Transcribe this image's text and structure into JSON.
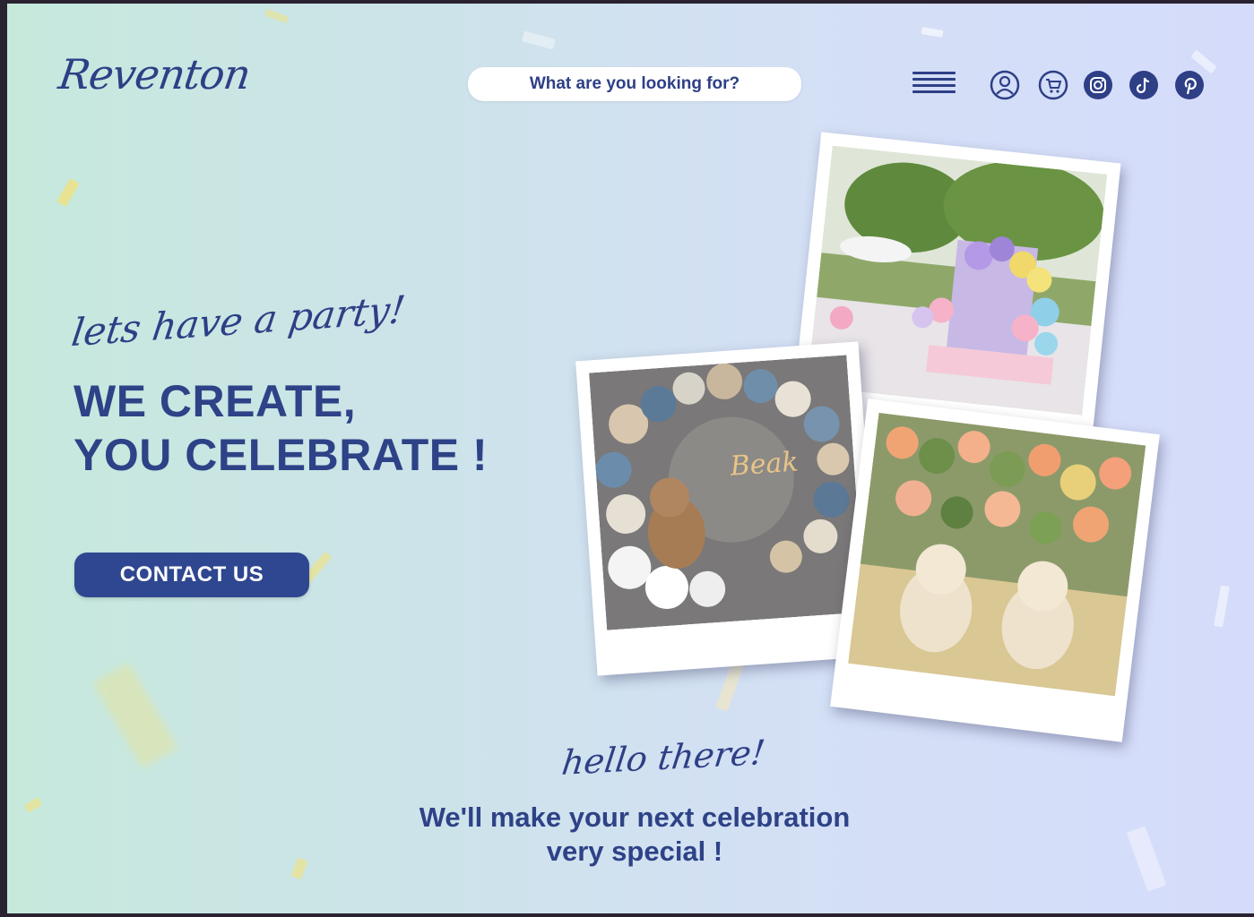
{
  "brand": {
    "logo_text": "Reventon"
  },
  "search": {
    "placeholder": "What are you looking for?"
  },
  "header_icons": [
    "menu-icon",
    "user-icon",
    "cart-icon",
    "instagram-icon",
    "tiktok-icon",
    "pinterest-icon"
  ],
  "hero": {
    "tagline": "lets have a party!",
    "headline_line1": "WE CREATE,",
    "headline_line2": "YOU CELEBRATE !",
    "cta_label": "CONTACT US"
  },
  "intro": {
    "greeting": "hello there!",
    "line1": "We'll make your next celebration",
    "line2": "very special !"
  },
  "colors": {
    "brand_blue": "#2e4287",
    "button_bg": "#2f4790",
    "bg_left": "#c6e9dc",
    "bg_right": "#d5dcfb"
  }
}
